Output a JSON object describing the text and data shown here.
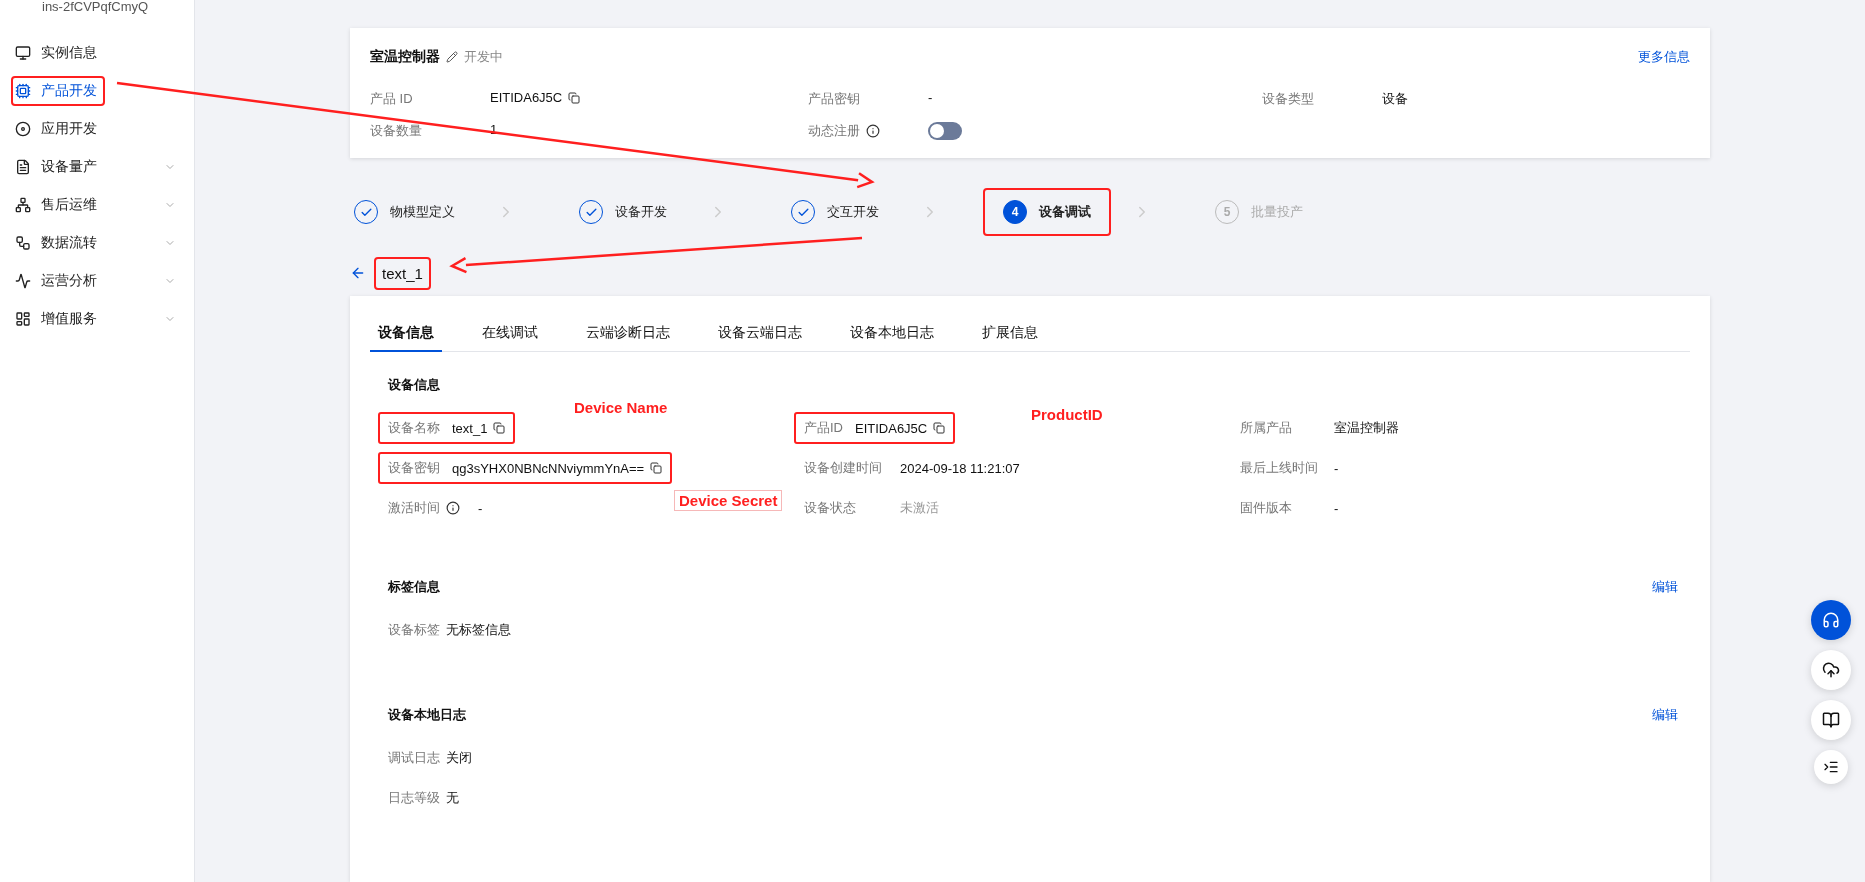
{
  "sidebar": {
    "instance_id": "ins-2fCVPqfCmyQ",
    "items": [
      {
        "label": "实例信息",
        "selected": false,
        "expandable": false,
        "annotated": false
      },
      {
        "label": "产品开发",
        "selected": true,
        "expandable": false,
        "annotated": true
      },
      {
        "label": "应用开发",
        "selected": false,
        "expandable": false,
        "annotated": false
      },
      {
        "label": "设备量产",
        "selected": false,
        "expandable": true,
        "annotated": false
      },
      {
        "label": "售后运维",
        "selected": false,
        "expandable": true,
        "annotated": false
      },
      {
        "label": "数据流转",
        "selected": false,
        "expandable": true,
        "annotated": false
      },
      {
        "label": "运营分析",
        "selected": false,
        "expandable": true,
        "annotated": false
      },
      {
        "label": "增值服务",
        "selected": false,
        "expandable": true,
        "annotated": false
      }
    ]
  },
  "product": {
    "name": "室温控制器",
    "status": "开发中",
    "more_link": "更多信息",
    "fields": [
      {
        "label": "产品 ID",
        "value": "EITIDA6J5C",
        "kind": "copy",
        "info": false
      },
      {
        "label": "产品密钥",
        "value": "-",
        "kind": "text",
        "info": false
      },
      {
        "label": "设备类型",
        "value": "设备",
        "kind": "text",
        "info": false
      },
      {
        "label": "设备数量",
        "value": "1",
        "kind": "text",
        "info": false
      },
      {
        "label": "动态注册",
        "kind": "toggle",
        "on": false,
        "info": true
      }
    ]
  },
  "steps": [
    {
      "label": "物模型定义",
      "kind": "done",
      "annotated": false
    },
    {
      "label": "设备开发",
      "kind": "done",
      "annotated": false
    },
    {
      "label": "交互开发",
      "kind": "done",
      "annotated": false
    },
    {
      "label": "设备调试",
      "number": "4",
      "kind": "active",
      "annotated": true
    },
    {
      "label": "批量投产",
      "number": "5",
      "kind": "pending",
      "annotated": false
    }
  ],
  "device_title": {
    "text": "text_1",
    "annotated": true
  },
  "tabs": [
    {
      "label": "设备信息",
      "selected": true
    },
    {
      "label": "在线调试",
      "selected": false
    },
    {
      "label": "云端诊断日志",
      "selected": false
    },
    {
      "label": "设备云端日志",
      "selected": false
    },
    {
      "label": "设备本地日志",
      "selected": false
    },
    {
      "label": "扩展信息",
      "selected": false
    }
  ],
  "device_info": {
    "title": "设备信息",
    "fields": [
      {
        "label": "设备名称",
        "value": "text_1",
        "kind": "copy",
        "info": false,
        "muted": false,
        "annotated": true
      },
      {
        "label": "产品ID",
        "value": "EITIDA6J5C",
        "kind": "copy",
        "info": false,
        "muted": false,
        "annotated": true
      },
      {
        "label": "所属产品",
        "value": "室温控制器",
        "kind": "text",
        "info": false,
        "muted": false,
        "annotated": false
      },
      {
        "label": "设备密钥",
        "value": "qg3sYHX0NBNcNNviymmYnA==",
        "kind": "copy",
        "info": false,
        "muted": false,
        "annotated": true
      },
      {
        "label": "设备创建时间",
        "value": "2024-09-18 11:21:07",
        "kind": "text",
        "info": false,
        "muted": false,
        "annotated": false
      },
      {
        "label": "最后上线时间",
        "value": "-",
        "kind": "text",
        "info": false,
        "muted": false,
        "annotated": false
      },
      {
        "label": "激活时间",
        "value": "-",
        "kind": "text",
        "info": true,
        "muted": false,
        "annotated": false
      },
      {
        "label": "设备状态",
        "value": "未激活",
        "kind": "text",
        "info": false,
        "muted": true,
        "annotated": false
      },
      {
        "label": "固件版本",
        "value": "-",
        "kind": "text",
        "info": false,
        "muted": false,
        "annotated": false
      }
    ]
  },
  "tag_info": {
    "title": "标签信息",
    "edit": "编辑",
    "fields": [
      {
        "label": "设备标签",
        "value": "无标签信息"
      }
    ]
  },
  "local_log": {
    "title": "设备本地日志",
    "edit": "编辑",
    "fields": [
      {
        "label": "调试日志",
        "value": "关闭"
      },
      {
        "label": "日志等级",
        "value": "无"
      }
    ]
  },
  "annotation_labels": [
    {
      "text": "Device Name",
      "boxed": false
    },
    {
      "text": "ProductID",
      "boxed": false
    },
    {
      "text": "Device Secret",
      "boxed": true
    }
  ]
}
